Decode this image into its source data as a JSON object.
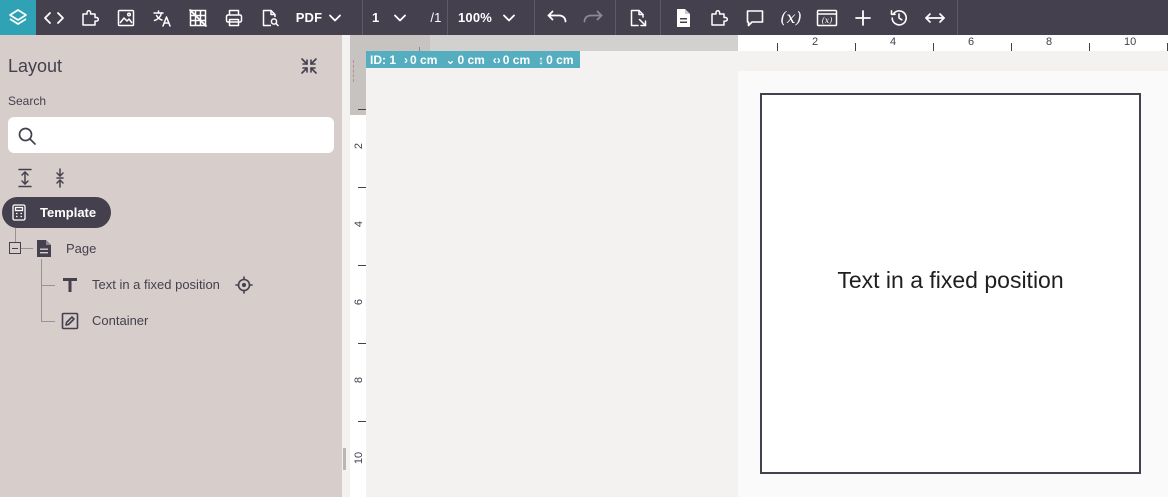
{
  "toolbar": {
    "format": "PDF",
    "page_current": "1",
    "page_total": "/1",
    "zoom": "100%",
    "variables_label": "(x)"
  },
  "sidebar": {
    "title": "Layout",
    "search_label": "Search",
    "search_value": "",
    "search_placeholder": ""
  },
  "tree": {
    "template": "Template",
    "page": "Page",
    "text_item": "Text in a fixed position",
    "container": "Container"
  },
  "ruler": {
    "top_numbers": [
      "2",
      "4",
      "6",
      "8",
      "10"
    ],
    "left_numbers": [
      "2",
      "4",
      "6",
      "8",
      "10"
    ]
  },
  "info_bar": {
    "id": "ID: 1",
    "x": "0 cm",
    "y": "0 cm",
    "width": "0 cm",
    "height": "0 cm"
  },
  "canvas": {
    "text": "Text in a fixed position"
  },
  "colors": {
    "toolbar_bg": "#44404e",
    "accent": "#2fa3b5",
    "sidebar_bg": "#d7cdcb",
    "info_bar": "#55aec0"
  }
}
